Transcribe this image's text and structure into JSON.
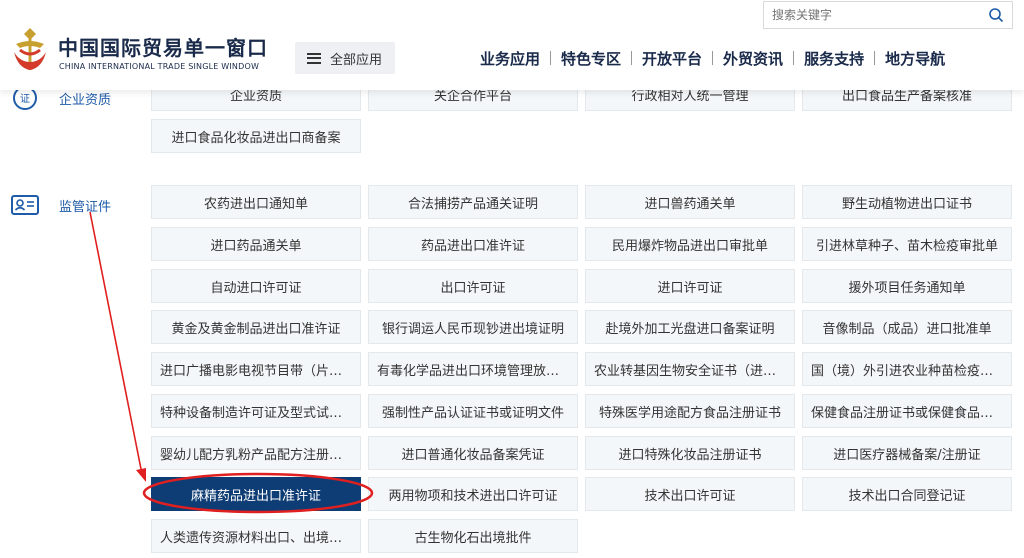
{
  "header": {
    "brand_cn": "中国国际贸易单一窗口",
    "brand_en": "CHINA INTERNATIONAL TRADE SINGLE WINDOW",
    "all_apps_label": "全部应用",
    "search_placeholder": "搜索关键字",
    "nav": [
      "业务应用",
      "特色专区",
      "开放平台",
      "外贸资讯",
      "服务支持",
      "地方导航"
    ]
  },
  "sections": {
    "enterprise": {
      "label": "企业资质",
      "icon": "certificate-icon",
      "partial_row": [
        "企业资质",
        "关企合作平台",
        "行政相对人统一管理",
        "出口食品生产备案核准"
      ],
      "items": [
        "进口食品化妆品进出口商备案"
      ]
    },
    "regulatory": {
      "label": "监管证件",
      "icon": "id-card-icon",
      "items": [
        "农药进出口通知单",
        "合法捕捞产品通关证明",
        "进口兽药通关单",
        "野生动植物进出口证书",
        "进口药品通关单",
        "药品进出口准许证",
        "民用爆炸物品进出口审批单",
        "引进林草种子、苗木检疫审批单",
        "自动进口许可证",
        "出口许可证",
        "进口许可证",
        "援外项目任务通知单",
        "黄金及黄金制品进出口准许证",
        "银行调运人民币现钞进出境证明",
        "赴境外加工光盘进口备案证明",
        "音像制品（成品）进口批准单",
        "进口广播电影电视节目带（片）...",
        "有毒化学品进出口环境管理放行...",
        "农业转基因生物安全证书（进口）",
        "国（境）外引进农业种苗检疫审...",
        "特种设备制造许可证及型式试验...",
        "强制性产品认证证书或证明文件",
        "特殊医学用途配方食品注册证书",
        "保健食品注册证书或保健食品备...",
        "婴幼儿配方乳粉产品配方注册证书",
        "进口普通化妆品备案凭证",
        "进口特殊化妆品注册证书",
        "进口医疗器械备案/注册证",
        "麻精药品进出口准许证",
        "两用物项和技术进出口许可证",
        "技术出口许可证",
        "技术出口合同登记证",
        "人类遗传资源材料出口、出境证明",
        "古生物化石出境批件"
      ],
      "highlighted_item": "麻精药品进出口准许证"
    }
  },
  "colors": {
    "accent": "#0e3c74",
    "link": "#1e5ba8",
    "annotation": "#e02020"
  }
}
